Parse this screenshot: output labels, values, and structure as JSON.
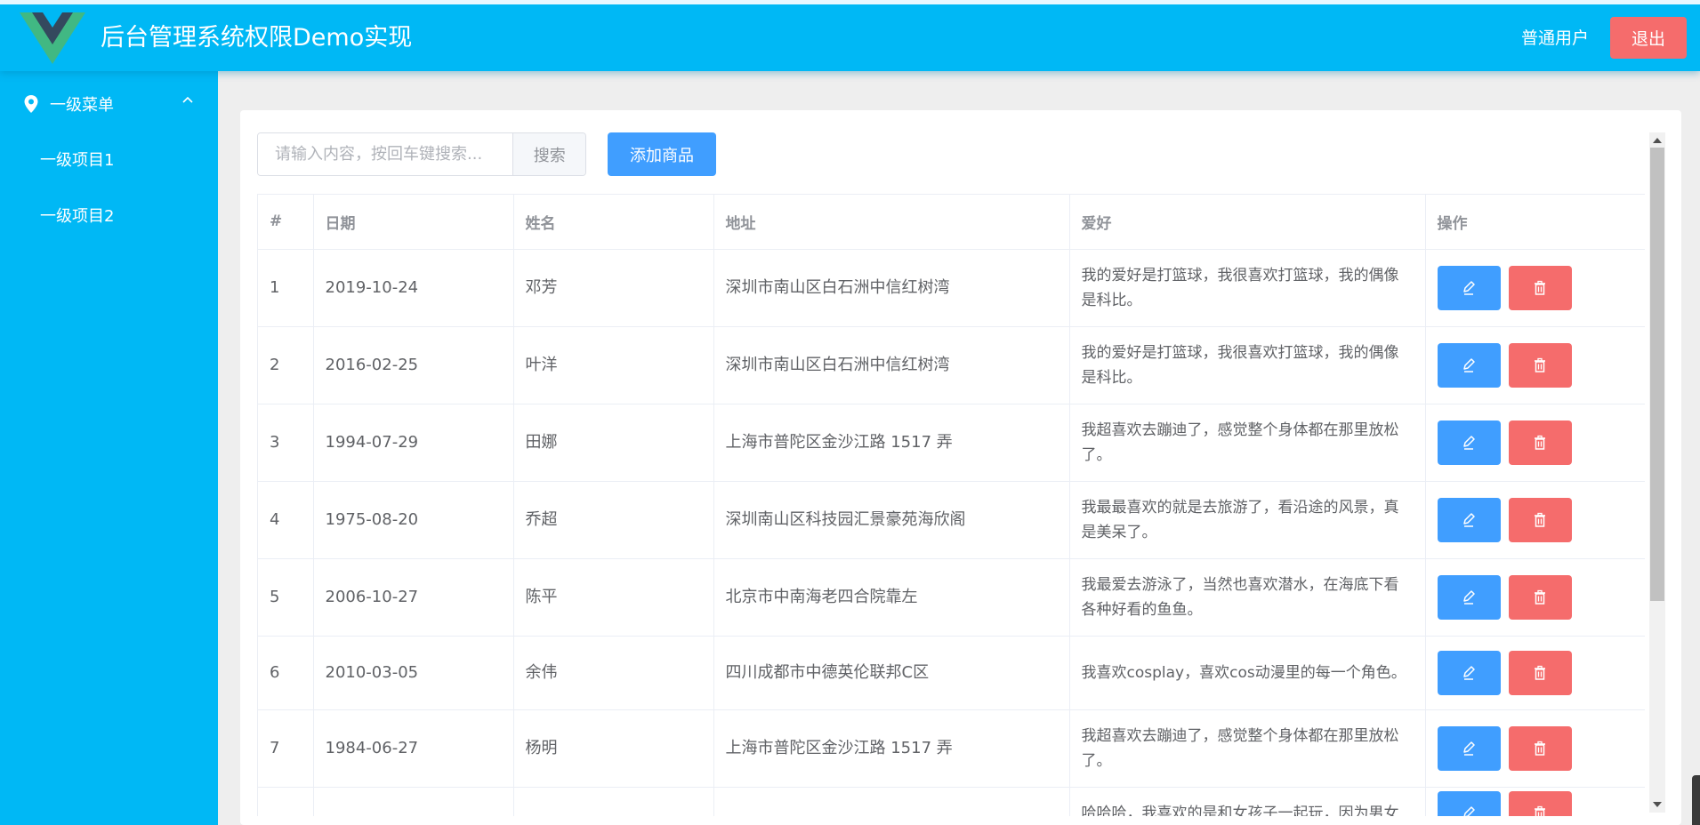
{
  "header": {
    "title": "后台管理系统权限Demo实现",
    "user_name": "普通用户",
    "logout_label": "退出",
    "background_color": "#00b8f5"
  },
  "sidebar": {
    "group_label": "一级菜单",
    "group_icon": "location-pin-icon",
    "items": [
      {
        "label": "一级项目1"
      },
      {
        "label": "一级项目2"
      }
    ]
  },
  "toolbar": {
    "search_placeholder": "请输入内容，按回车键搜索...",
    "search_value": "",
    "search_label": "搜索",
    "add_label": "添加商品"
  },
  "table": {
    "columns": [
      "#",
      "日期",
      "姓名",
      "地址",
      "爱好",
      "操作"
    ],
    "rows": [
      {
        "index": "1",
        "date": "2019-10-24",
        "name": "邓芳",
        "address": "深圳市南山区白石洲中信红树湾",
        "hobby": "我的爱好是打篮球，我很喜欢打篮球，我的偶像是科比。"
      },
      {
        "index": "2",
        "date": "2016-02-25",
        "name": "叶洋",
        "address": "深圳市南山区白石洲中信红树湾",
        "hobby": "我的爱好是打篮球，我很喜欢打篮球，我的偶像是科比。"
      },
      {
        "index": "3",
        "date": "1994-07-29",
        "name": "田娜",
        "address": "上海市普陀区金沙江路 1517 弄",
        "hobby": "我超喜欢去蹦迪了，感觉整个身体都在那里放松了。"
      },
      {
        "index": "4",
        "date": "1975-08-20",
        "name": "乔超",
        "address": "深圳南山区科技园汇景豪苑海欣阁",
        "hobby": "我最最喜欢的就是去旅游了，看沿途的风景，真是美呆了。"
      },
      {
        "index": "5",
        "date": "2006-10-27",
        "name": "陈平",
        "address": "北京市中南海老四合院靠左",
        "hobby": "我最爱去游泳了，当然也喜欢潜水，在海底下看各种好看的鱼鱼。"
      },
      {
        "index": "6",
        "date": "2010-03-05",
        "name": "余伟",
        "address": "四川成都市中德英伦联邦C区",
        "hobby": "我喜欢cosplay，喜欢cos动漫里的每一个角色。"
      },
      {
        "index": "7",
        "date": "1984-06-27",
        "name": "杨明",
        "address": "上海市普陀区金沙江路 1517 弄",
        "hobby": "我超喜欢去蹦迪了，感觉整个身体都在那里放松了。"
      },
      {
        "index": "",
        "date": "",
        "name": "",
        "address": "",
        "hobby": "哈哈哈，我喜欢的是和女孩子一起玩，因为男女"
      }
    ],
    "edit_icon": "pencil-icon",
    "delete_icon": "trash-icon",
    "edit_color": "#409eff",
    "delete_color": "#f56c6c"
  }
}
